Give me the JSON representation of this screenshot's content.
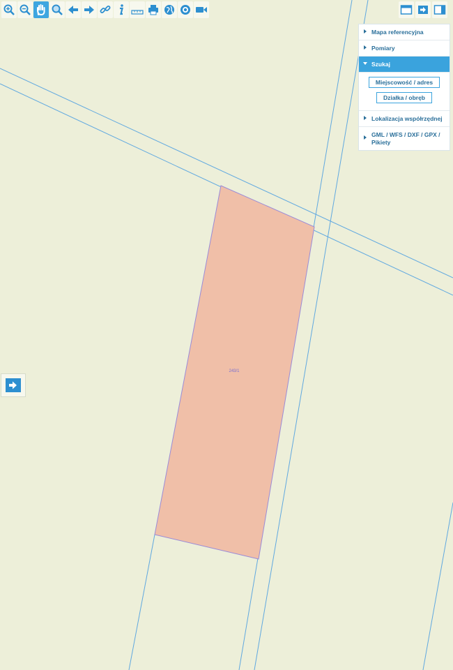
{
  "map": {
    "parcel_label": "243/1",
    "colors": {
      "background": "#edefd9",
      "boundary": "#5fa8e0",
      "parcel_fill": "#f0bfa8",
      "parcel_stroke": "#9a8bd8",
      "accent": "#3aa3dd"
    }
  },
  "toolbar": {
    "tools": [
      "zoom-in-icon",
      "zoom-out-icon",
      "pan-hand-icon",
      "zoom-area-icon",
      "back-arrow-icon",
      "forward-arrow-icon",
      "link-icon",
      "info-icon",
      "measure-icon",
      "print-icon",
      "globe-icon",
      "target-icon",
      "camera-icon"
    ],
    "active": "pan-hand-icon",
    "right": [
      "window-layout-icon",
      "export-icon",
      "panel-toggle-icon"
    ]
  },
  "panel": {
    "items": [
      {
        "label": "Mapa referencyjna"
      },
      {
        "label": "Pomiary"
      },
      {
        "label": "Szukaj"
      },
      {
        "label": "Lokalizacja współrzędnej"
      },
      {
        "label": "GML / WFS / DXF / GPX / Pikiety"
      }
    ],
    "search_buttons": [
      {
        "label": "Miejscowość / adres"
      },
      {
        "label": "Działka / obręb"
      }
    ]
  }
}
